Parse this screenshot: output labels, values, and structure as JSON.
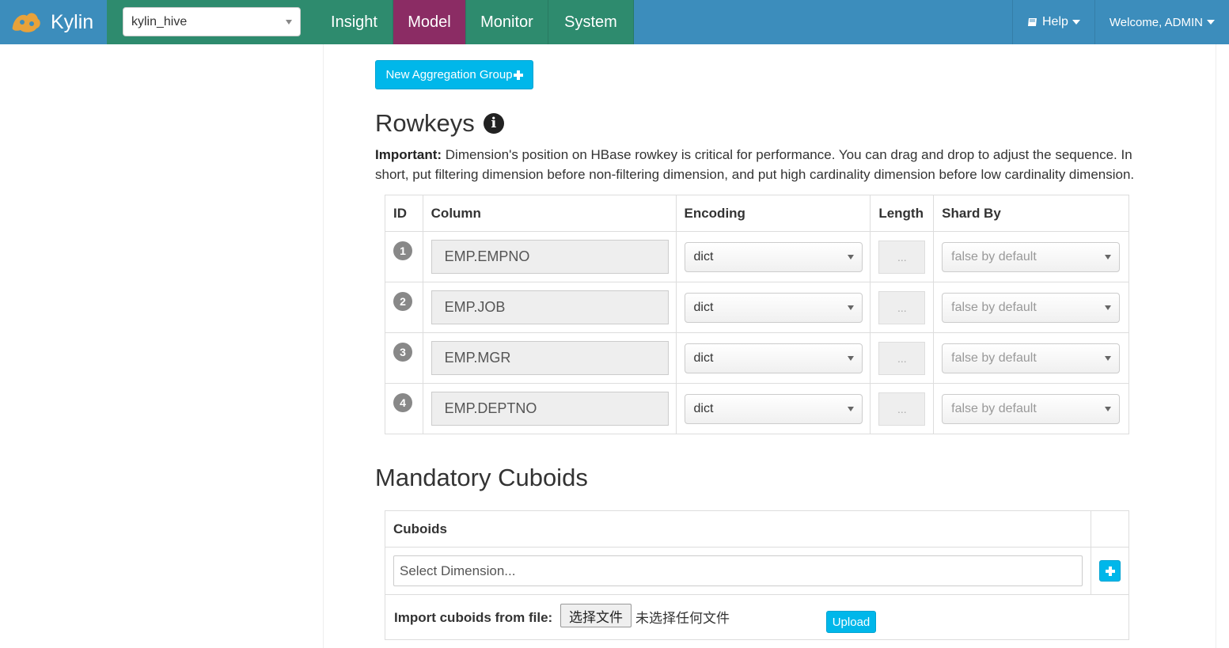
{
  "navbar": {
    "brand": "Kylin",
    "project": "kylin_hive",
    "tabs": [
      {
        "label": "Insight",
        "active": false
      },
      {
        "label": "Model",
        "active": true
      },
      {
        "label": "Monitor",
        "active": false
      },
      {
        "label": "System",
        "active": false
      }
    ],
    "help": "Help",
    "welcome": "Welcome, ADMIN"
  },
  "colors": {
    "navbar_bg": "#3c8dbc",
    "nav_tab_bg": "#2e8b6e",
    "nav_tab_active": "#8b2c64",
    "accent_button": "#00b7ea"
  },
  "aggregation": {
    "new_button": "New Aggregation Group"
  },
  "rowkeys": {
    "title": "Rowkeys",
    "important_label": "Important:",
    "important_text": " Dimension's position on HBase rowkey is critical for performance. You can drag and drop to adjust the sequence. In short, put filtering dimension before non-filtering dimension, and put high cardinality dimension before low cardinality dimension.",
    "headers": [
      "ID",
      "Column",
      "Encoding",
      "Length",
      "Shard By"
    ],
    "rows": [
      {
        "id": "1",
        "column": "EMP.EMPNO",
        "encoding": "dict",
        "length": "...",
        "shard_by": "false by default"
      },
      {
        "id": "2",
        "column": "EMP.JOB",
        "encoding": "dict",
        "length": "...",
        "shard_by": "false by default"
      },
      {
        "id": "3",
        "column": "EMP.MGR",
        "encoding": "dict",
        "length": "...",
        "shard_by": "false by default"
      },
      {
        "id": "4",
        "column": "EMP.DEPTNO",
        "encoding": "dict",
        "length": "...",
        "shard_by": "false by default"
      }
    ]
  },
  "mandatory": {
    "title": "Mandatory Cuboids",
    "header": "Cuboids",
    "dimension_placeholder": "Select Dimension...",
    "import_label": "Import cuboids from file:",
    "choose_file": "选择文件",
    "no_file": "未选择任何文件",
    "upload": "Upload"
  }
}
